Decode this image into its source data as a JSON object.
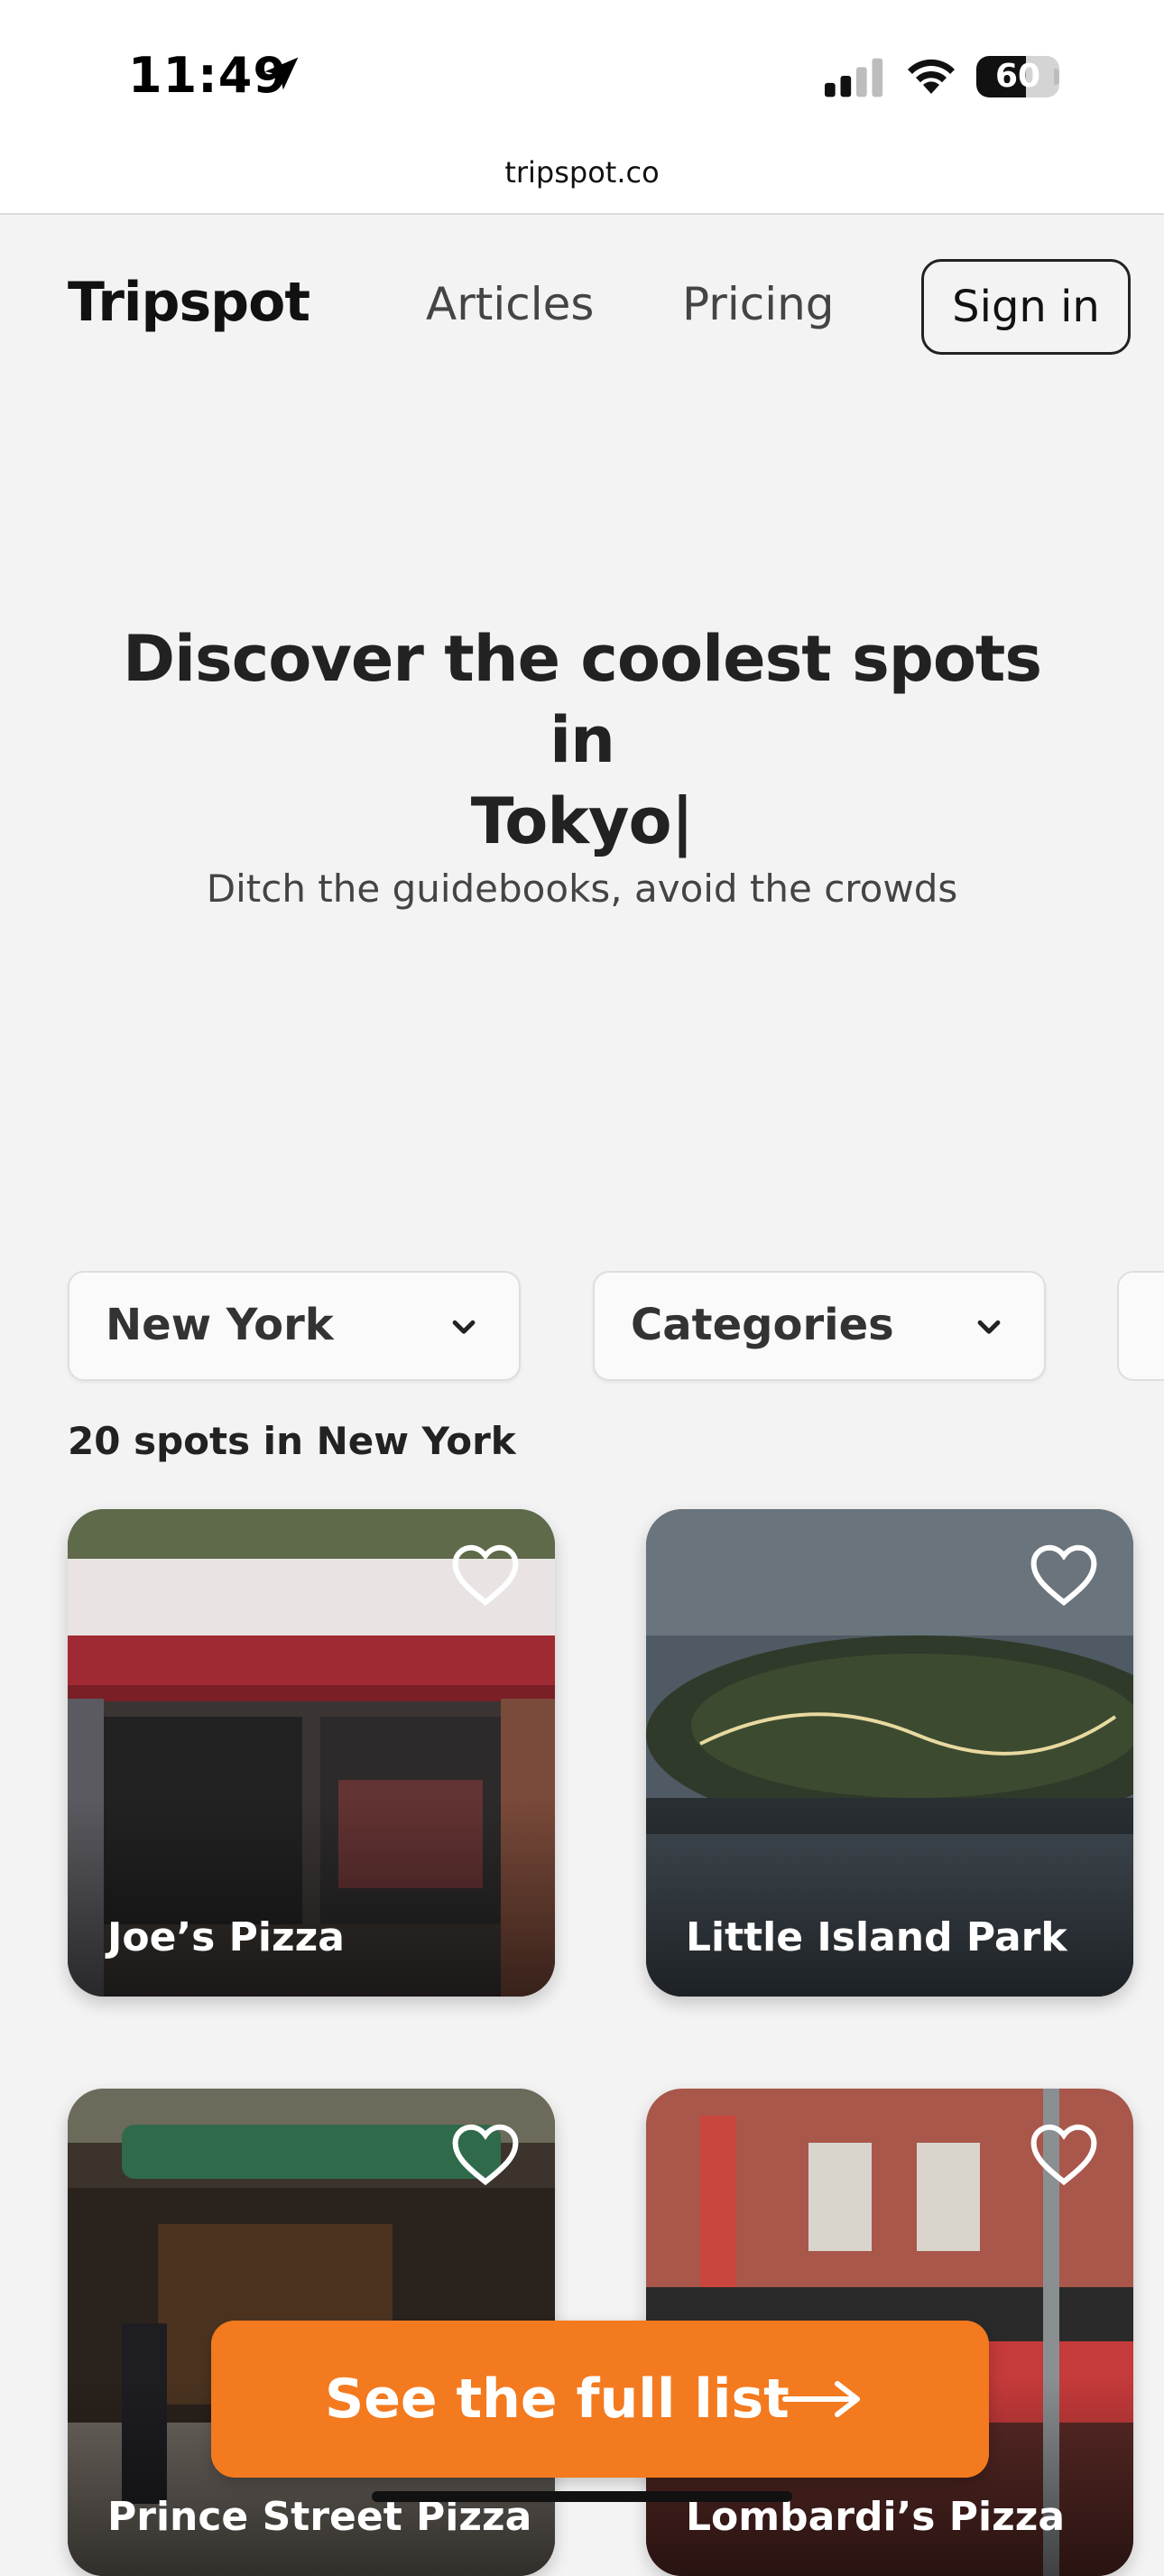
{
  "status_bar": {
    "time": "11:49",
    "battery": "60",
    "battery_level": 0.6
  },
  "browser": {
    "url": "tripspot.co"
  },
  "nav": {
    "brand": "Tripspot",
    "links": [
      "Articles",
      "Pricing"
    ],
    "signin_label": "Sign in"
  },
  "hero": {
    "title_line1": "Discover the coolest spots in",
    "title_line2": "Tokyo|",
    "subtitle": "Ditch the guidebooks, avoid the crowds"
  },
  "filters": {
    "city": "New York",
    "categories": "Categories"
  },
  "results": {
    "count_text": "20 spots in New York"
  },
  "spots": [
    {
      "name": "Joe’s Pizza"
    },
    {
      "name": "Little Island Park"
    },
    {
      "name": "Prince Street Pizza"
    },
    {
      "name": "Lombardi’s Pizza"
    }
  ],
  "cta": {
    "label": "See the full list"
  },
  "icons": {
    "location": "location-arrow-icon",
    "signal": "cellular-signal-icon",
    "wifi": "wifi-icon",
    "favorite": "heart-outline-icon",
    "dropdown": "chevron-down-icon",
    "cta_arrow": "arrow-right-icon"
  },
  "colors": {
    "accent": "#f37a1f",
    "background": "#f3f3f3",
    "text": "#222222"
  }
}
